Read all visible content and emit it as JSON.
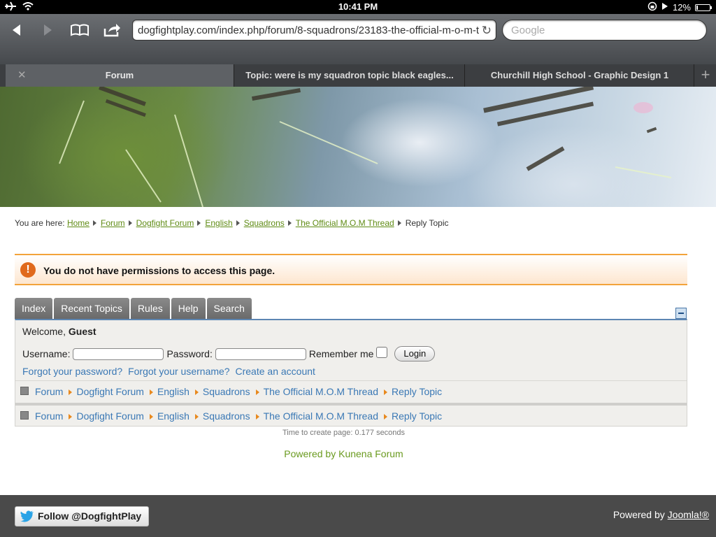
{
  "status_bar": {
    "time": "10:41 PM",
    "battery": "12%",
    "battery_level": 0.12
  },
  "browser": {
    "url": "dogfightplay.com/index.php/forum/8-squadrons/23183-the-official-m-o-m-t",
    "search_placeholder": "Google",
    "tabs": [
      {
        "label": "Forum",
        "active": true
      },
      {
        "label": "Topic: were is my squadron topic black eagles..."
      },
      {
        "label": "Churchill High School - Graphic Design 1"
      }
    ]
  },
  "breadcrumb": {
    "prefix": "You are here:",
    "items": [
      "Home",
      "Forum",
      "Dogfight Forum",
      "English",
      "Squadrons",
      "The Official M.O.M Thread"
    ],
    "current": "Reply Topic"
  },
  "alert": {
    "icon": "!",
    "message": "You do not have permissions to access this page."
  },
  "forum_tabs": [
    "Index",
    "Recent Topics",
    "Rules",
    "Help",
    "Search"
  ],
  "login": {
    "welcome_prefix": "Welcome,",
    "user": "Guest",
    "username_label": "Username:",
    "password_label": "Password:",
    "remember_label": "Remember me",
    "login_button": "Login",
    "links": [
      "Forgot your password?",
      "Forgot your username?",
      "Create an account"
    ]
  },
  "pathway": {
    "items": [
      "Forum",
      "Dogfight Forum",
      "English",
      "Squadrons",
      "The Official M.O.M Thread",
      "Reply Topic"
    ]
  },
  "timing": "Time to create page: 0.177 seconds",
  "powered_by_kunena": "Powered by Kunena Forum",
  "footer": {
    "follow": "Follow @DogfightPlay",
    "powered_prefix": "Powered by",
    "joomla": "Joomla!®"
  },
  "colors": {
    "link_green": "#5f8b14",
    "link_blue": "#3a78b5",
    "alert_border": "#f3a33a",
    "alert_icon": "#e06a1c"
  }
}
